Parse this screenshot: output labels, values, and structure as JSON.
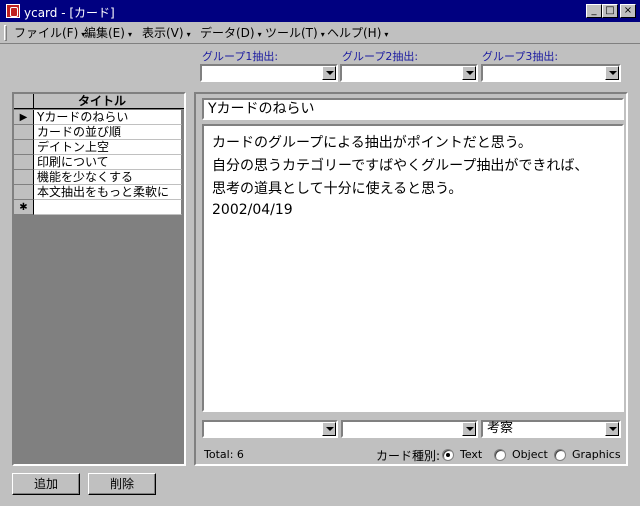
{
  "window": {
    "title": "ycard - [カード]",
    "controls": [
      "_",
      "□",
      "×"
    ]
  },
  "menubar": {
    "items": [
      {
        "label": "ファイル(F)"
      },
      {
        "label": "編集(E)"
      },
      {
        "label": "表示(V)"
      },
      {
        "label": "データ(D)"
      },
      {
        "label": "ツール(T)"
      },
      {
        "label": "ヘルプ(H)"
      }
    ],
    "arrow": "▾"
  },
  "filters": {
    "group1_label": "グループ1抽出:",
    "group2_label": "グループ2抽出:",
    "group3_label": "グループ3抽出:",
    "group1_value": "",
    "group2_value": "",
    "group3_value": ""
  },
  "list": {
    "header": "タイトル",
    "rows": [
      {
        "title": "Yカードのねらい",
        "selector": "▶"
      },
      {
        "title": "カードの並び順",
        "selector": ""
      },
      {
        "title": "デイトン上空",
        "selector": ""
      },
      {
        "title": "印刷について",
        "selector": ""
      },
      {
        "title": "機能を少なくする",
        "selector": ""
      },
      {
        "title": "本文抽出をもっと柔軟に",
        "selector": ""
      }
    ],
    "new_row_marker": "✱"
  },
  "card": {
    "title": "Yカードのねらい",
    "body_lines": [
      "カードのグループによる抽出がポイントだと思う。",
      "自分の思うカテゴリーですばやくグループ抽出ができれば、",
      "思考の道具として十分に使えると思う。",
      "2002/04/19"
    ],
    "group1_value": "",
    "group2_value": "",
    "group3_value": "考察"
  },
  "status": {
    "total": "Total: 6",
    "card_type_label": "カード種別:",
    "options": [
      {
        "label": "Text",
        "selected": true
      },
      {
        "label": "Object",
        "selected": false
      },
      {
        "label": "Graphics",
        "selected": false
      }
    ]
  },
  "buttons": {
    "add": "追加",
    "delete": "削除"
  }
}
